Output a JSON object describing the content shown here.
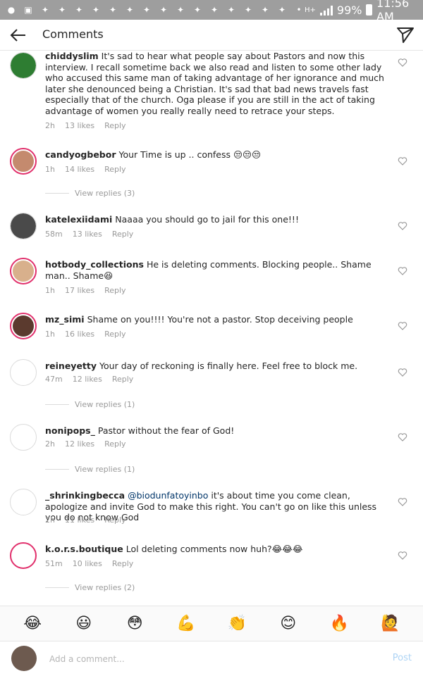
{
  "status_bar": {
    "network": "H+",
    "battery": "99%",
    "time": "11:56 AM"
  },
  "header": {
    "title": "Comments",
    "back_icon": "arrow-left-icon",
    "send_icon": "paper-plane-icon"
  },
  "comments": [
    {
      "username": "chiddyslim",
      "text": "It's sad to hear what people say about Pastors and now this interview. I recall sometime back we also read and listen to some other lady who accused this same man of taking advantage of her ignorance and much later she denounced being a Christian. It's sad that bad news travels fast especially that of the church. Oga please if you are still in the act of taking advantage of women you really really need to retrace your steps.",
      "time": "2h",
      "likes": "13 likes",
      "reply": "Reply",
      "view_replies": "",
      "avatar_color": "#2e7d32"
    },
    {
      "username": "candyogbebor",
      "text": "Your Time is up .. confess 😒😒😒",
      "time": "1h",
      "likes": "14 likes",
      "reply": "Reply",
      "view_replies": "View replies (3)",
      "avatar_color": "#c48a6e"
    },
    {
      "username": "katelexiidami",
      "text": "Naaaa you should go to jail for this one!!!",
      "time": "58m",
      "likes": "13 likes",
      "reply": "Reply",
      "view_replies": "",
      "avatar_color": "#4a4a4a"
    },
    {
      "username": "hotbody_collections",
      "text": "He is deleting comments. Blocking people.. Shame man.. Shame😆",
      "time": "1h",
      "likes": "17 likes",
      "reply": "Reply",
      "view_replies": "",
      "avatar_color": "#d8b08c"
    },
    {
      "username": "mz_simi",
      "text": "Shame on you!!!! You're not a pastor. Stop deceiving people",
      "time": "1h",
      "likes": "16 likes",
      "reply": "Reply",
      "view_replies": "",
      "avatar_color": "#5b3a2e"
    },
    {
      "username": "reineyetty",
      "text": "Your day of reckoning is finally here. Feel free to block me.",
      "time": "47m",
      "likes": "12 likes",
      "reply": "Reply",
      "view_replies": "View replies (1)",
      "avatar_color": ""
    },
    {
      "username": "nonipops_",
      "text": "Pastor without the fear of God!",
      "time": "2h",
      "likes": "12 likes",
      "reply": "Reply",
      "view_replies": "View replies (1)",
      "avatar_color": ""
    },
    {
      "username": "_shrinkingbecca",
      "mention": "@biodunfatoyinbo",
      "text": "it's about time you come clean, apologize and invite God to make this right. You can't go on like this unless you do not know God",
      "time": "2h",
      "likes": "11 likes",
      "reply": "Reply",
      "view_replies": "",
      "avatar_color": ""
    },
    {
      "username": "k.o.r.s.boutique",
      "text": "Lol deleting comments now huh?😂😂😂",
      "time": "51m",
      "likes": "10 likes",
      "reply": "Reply",
      "view_replies": "View replies (2)",
      "avatar_color": ""
    }
  ],
  "emoji_bar": [
    "😂",
    "😃",
    "😳",
    "💪",
    "👏",
    "😊",
    "🔥",
    "🙋"
  ],
  "input": {
    "placeholder": "Add a comment...",
    "post_label": "Post"
  },
  "colors": {
    "ring": "#e1306c",
    "link": "#003569",
    "post": "#aed4f5"
  }
}
